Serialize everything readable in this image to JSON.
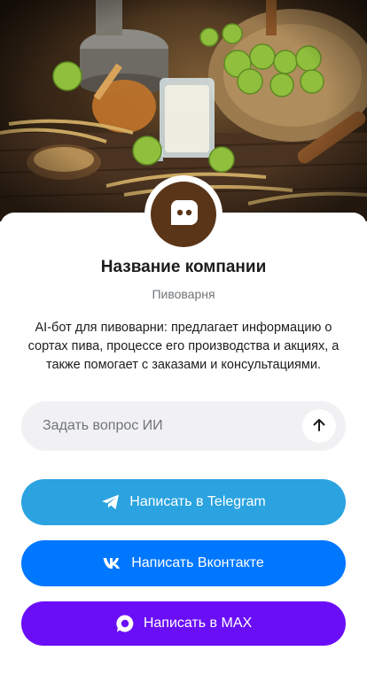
{
  "profile": {
    "company_name": "Название компании",
    "company_type": "Пивоварня",
    "description": "AI-бот для пивоварни: предлагает информацию о сортах пива, процессе его производства и акциях, а также помогает с заказами и консультациями.",
    "avatar_icon": "chat-bubble-icon",
    "avatar_color": "#5a3518"
  },
  "ask": {
    "placeholder": "Задать вопрос ИИ",
    "send_icon": "arrow-up-icon"
  },
  "buttons": {
    "telegram": {
      "label": "Написать в Telegram",
      "icon": "telegram-icon",
      "color": "#2aa3e0"
    },
    "vk": {
      "label": "Написать Вконтакте",
      "icon": "vk-icon",
      "color": "#0077ff"
    },
    "max": {
      "label": "Написать в MAX",
      "icon": "max-icon",
      "color": "#6a0ef7"
    }
  }
}
